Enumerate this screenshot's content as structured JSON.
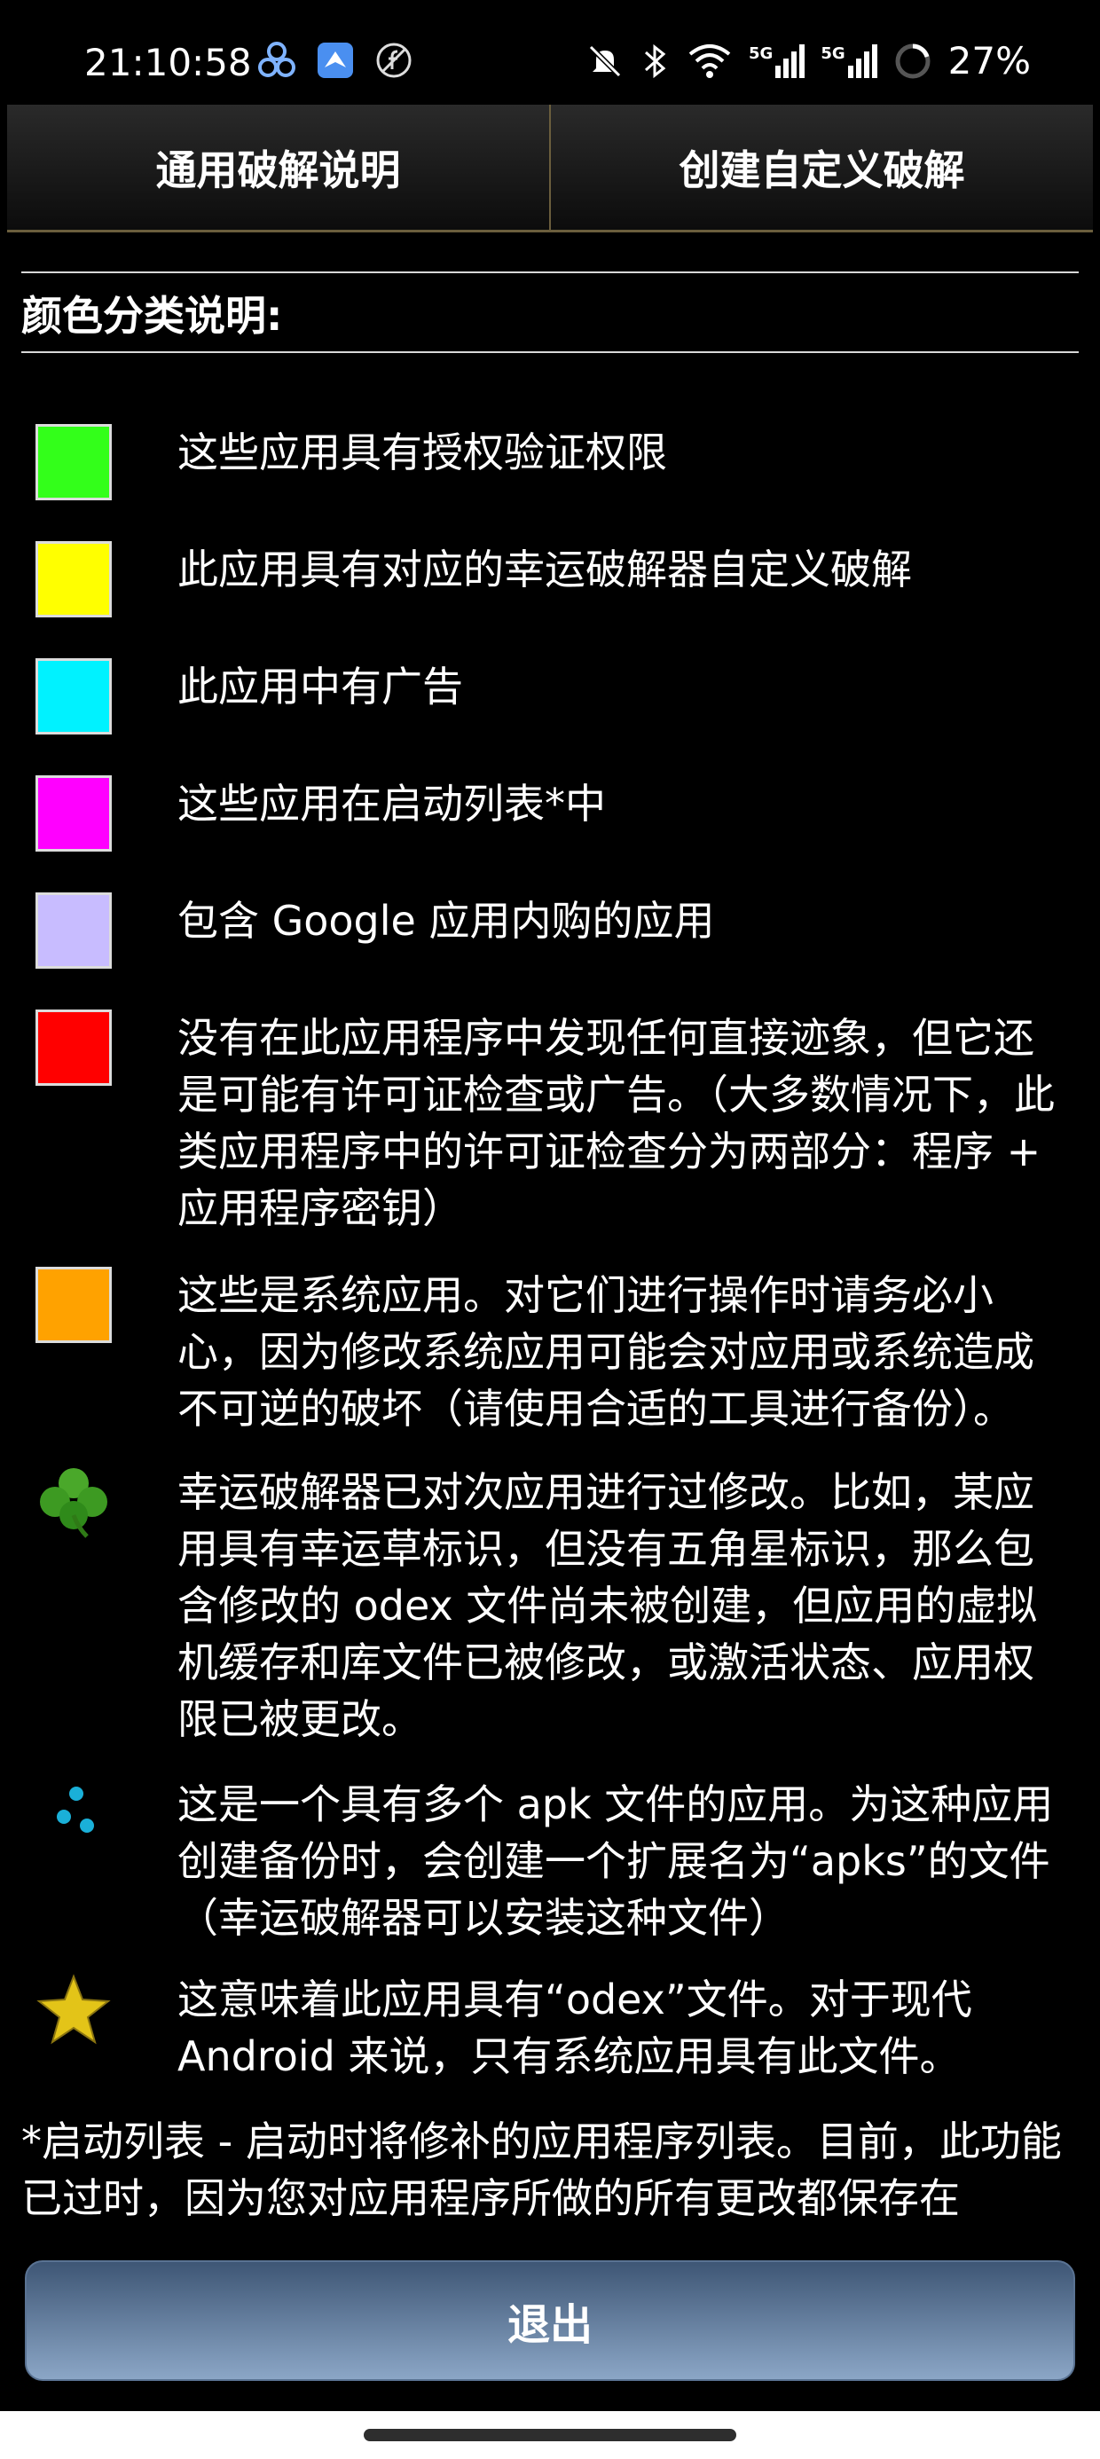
{
  "status_bar": {
    "time": "21:10:58",
    "battery_pct": "27%",
    "left_icons": [
      "app-cluster-icon",
      "bird-app-icon",
      "no-f-icon"
    ],
    "right_icons": [
      "mute-icon",
      "bluetooth-icon",
      "wifi-icon",
      "signal-5g-icon",
      "signal-5g-icon",
      "battery-ring-icon"
    ],
    "net1": "5G",
    "net2": "5G"
  },
  "tabs": [
    {
      "label": "通用破解说明"
    },
    {
      "label": "创建自定义破解"
    }
  ],
  "section": {
    "title": "颜色分类说明:"
  },
  "legend": [
    {
      "color": "#33ff1a",
      "text": "这些应用具有授权验证权限"
    },
    {
      "color": "#ffff00",
      "text": "此应用具有对应的幸运破解器自定义破解"
    },
    {
      "color": "#00f2ff",
      "text": "此应用中有广告"
    },
    {
      "color": "#ff00ff",
      "text": "这些应用在启动列表*中"
    },
    {
      "color": "#c8bcff",
      "text": "包含 Google 应用内购的应用"
    },
    {
      "color": "#ff0000",
      "text": "没有在此应用程序中发现任何直接迹象，但它还是可能有许可证检查或广告。（大多数情况下，此类应用程序中的许可证检查分为两部分：程序 + 应用程序密钥）"
    },
    {
      "color": "#ffa200",
      "text": "这些是系统应用。对它们进行操作时请务必小心，因为修改系统应用可能会对应用或系统造成不可逆的破坏（请使用合适的工具进行备份）。"
    },
    {
      "icon": "clover-icon",
      "text": "幸运破解器已对次应用进行过修改。比如，某应用具有幸运草标识，但没有五角星标识，那么包含修改的 odex 文件尚未被创建，但应用的虚拟机缓存和库文件已被修改，或激活状态、应用权限已被更改。"
    },
    {
      "icon": "split-apk-icon",
      "text": "这是一个具有多个 apk 文件的应用。为这种应用创建备份时，会创建一个扩展名为“apks”的文件（幸运破解器可以安装这种文件）"
    },
    {
      "icon": "star-icon",
      "text": "这意味着此应用具有“odex”文件。对于现代 Android 来说，只有系统应用具有此文件。"
    }
  ],
  "footnote": "*启动列表 - 启动时将修补的应用程序列表。目前，此功能已过时，因为您对应用程序所做的所有更改都保存在 ODEX 中，无法移至任何地方。因此，您只需通过修改",
  "exit_label": "退出"
}
